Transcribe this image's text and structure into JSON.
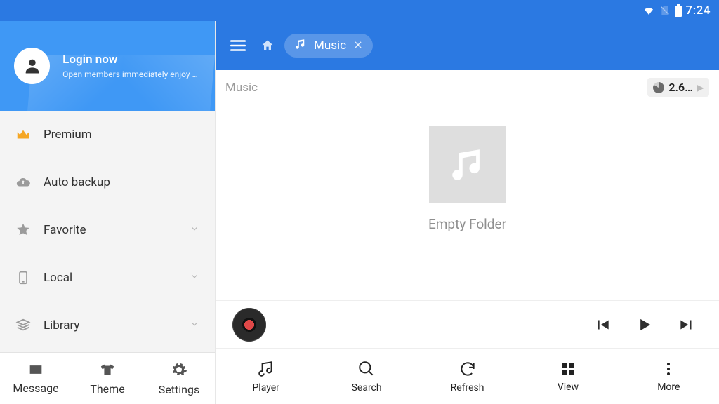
{
  "statusbar": {
    "clock": "7:24"
  },
  "sidebar": {
    "login": {
      "title": "Login now",
      "subtitle": "Open members immediately enjoy all…"
    },
    "items": [
      {
        "label": "Premium",
        "icon": "crown",
        "expandable": false
      },
      {
        "label": "Auto backup",
        "icon": "cloud",
        "expandable": false
      },
      {
        "label": "Favorite",
        "icon": "star",
        "expandable": true
      },
      {
        "label": "Local",
        "icon": "device",
        "expandable": true
      },
      {
        "label": "Library",
        "icon": "layers",
        "expandable": true
      }
    ],
    "bottom": [
      {
        "label": "Message",
        "icon": "mail"
      },
      {
        "label": "Theme",
        "icon": "tshirt"
      },
      {
        "label": "Settings",
        "icon": "gear"
      }
    ]
  },
  "header": {
    "tab": {
      "label": "Music"
    }
  },
  "path": {
    "current": "Music"
  },
  "storage": {
    "label": "2.6…"
  },
  "content": {
    "empty_label": "Empty Folder"
  },
  "bottomnav": [
    {
      "label": "Player",
      "icon": "music"
    },
    {
      "label": "Search",
      "icon": "search"
    },
    {
      "label": "Refresh",
      "icon": "refresh"
    },
    {
      "label": "View",
      "icon": "grid"
    },
    {
      "label": "More",
      "icon": "more"
    }
  ]
}
